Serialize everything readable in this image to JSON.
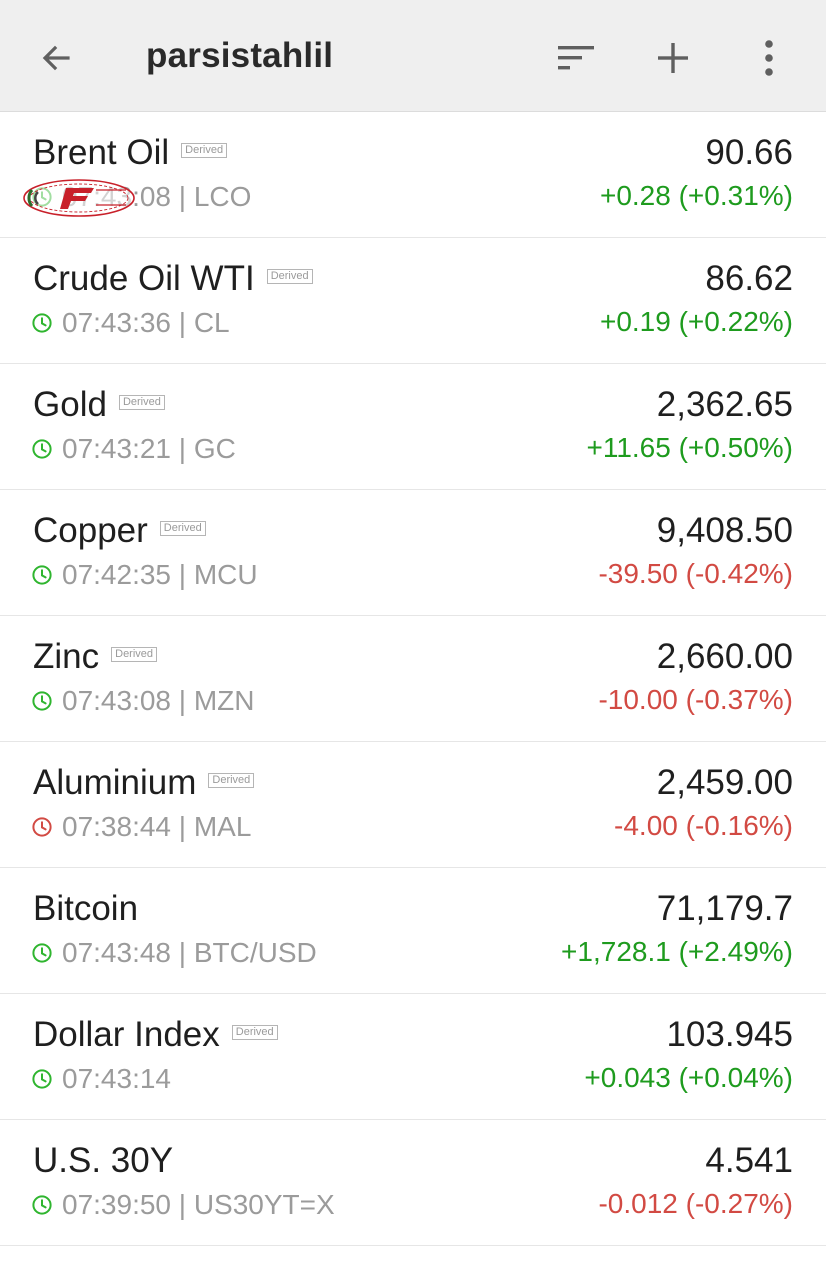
{
  "appbar": {
    "title": "parsistahlil",
    "icons": {
      "back": "back-arrow-icon",
      "sort": "sort-icon",
      "add": "plus-icon",
      "more": "more-vert-icon"
    }
  },
  "colors": {
    "up": "#1e9b1e",
    "down": "#d24a43",
    "clock_normal": "#2fb52f",
    "clock_alert": "#d24a43",
    "appbar_bg": "#efefef"
  },
  "derived_label": "Derived",
  "items": [
    {
      "name": "Brent Oil",
      "derived": true,
      "time": "07:43:08",
      "symbol": "LCO",
      "meta": "07:43:08 | LCO",
      "price": "90.66",
      "change": "+0.28 (+0.31%)",
      "direction": "up",
      "clock": "normal",
      "watermark": true
    },
    {
      "name": "Crude Oil WTI",
      "derived": true,
      "time": "07:43:36",
      "symbol": "CL",
      "meta": "07:43:36 | CL",
      "price": "86.62",
      "change": "+0.19 (+0.22%)",
      "direction": "up",
      "clock": "normal"
    },
    {
      "name": "Gold",
      "derived": true,
      "time": "07:43:21",
      "symbol": "GC",
      "meta": "07:43:21 | GC",
      "price": "2,362.65",
      "change": "+11.65 (+0.50%)",
      "direction": "up",
      "clock": "normal"
    },
    {
      "name": "Copper",
      "derived": true,
      "time": "07:42:35",
      "symbol": "MCU",
      "meta": "07:42:35 | MCU",
      "price": "9,408.50",
      "change": "-39.50 (-0.42%)",
      "direction": "down",
      "clock": "normal"
    },
    {
      "name": "Zinc",
      "derived": true,
      "time": "07:43:08",
      "symbol": "MZN",
      "meta": "07:43:08 | MZN",
      "price": "2,660.00",
      "change": "-10.00 (-0.37%)",
      "direction": "down",
      "clock": "normal"
    },
    {
      "name": "Aluminium",
      "derived": true,
      "time": "07:38:44",
      "symbol": "MAL",
      "meta": "07:38:44 | MAL",
      "price": "2,459.00",
      "change": "-4.00 (-0.16%)",
      "direction": "down",
      "clock": "alert"
    },
    {
      "name": "Bitcoin",
      "derived": false,
      "time": "07:43:48",
      "symbol": "BTC/USD",
      "meta": "07:43:48 | BTC/USD",
      "price": "71,179.7",
      "change": "+1,728.1 (+2.49%)",
      "direction": "up",
      "clock": "normal"
    },
    {
      "name": "Dollar Index",
      "derived": true,
      "time": "07:43:14",
      "symbol": "",
      "meta": "07:43:14",
      "price": "103.945",
      "change": "+0.043 (+0.04%)",
      "direction": "up",
      "clock": "normal"
    },
    {
      "name": "U.S. 30Y",
      "derived": false,
      "time": "07:39:50",
      "symbol": "US30YT=X",
      "meta": "07:39:50 | US30YT=X",
      "price": "4.541",
      "change": "-0.012 (-0.27%)",
      "direction": "down",
      "clock": "normal"
    }
  ]
}
